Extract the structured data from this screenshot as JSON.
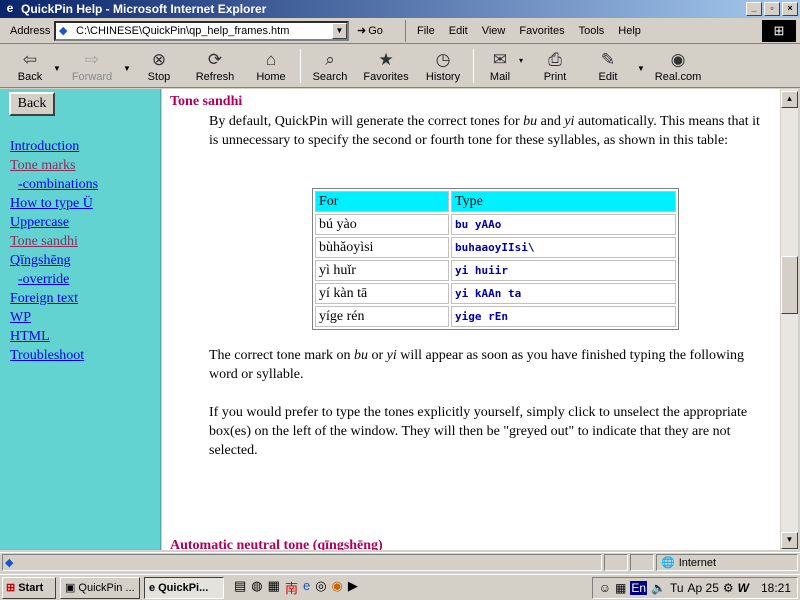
{
  "window": {
    "title": "QuickPin Help - Microsoft Internet Explorer"
  },
  "address": {
    "label": "Address",
    "value": "C:\\CHINESE\\QuickPin\\qp_help_frames.htm",
    "go": "Go"
  },
  "menu": [
    "File",
    "Edit",
    "View",
    "Favorites",
    "Tools",
    "Help"
  ],
  "toolbar": {
    "back": "Back",
    "forward": "Forward",
    "stop": "Stop",
    "refresh": "Refresh",
    "home": "Home",
    "search": "Search",
    "favorites": "Favorites",
    "history": "History",
    "mail": "Mail",
    "print": "Print",
    "edit": "Edit",
    "real": "Real.com"
  },
  "sidebar": {
    "back_button": "Back",
    "links": [
      "Introduction",
      "Tone marks",
      "-combinations",
      "How to type Ü",
      "Uppercase",
      "Tone sandhi",
      "Qīngshēng",
      "-override",
      "Foreign text",
      "WP",
      "HTML",
      "Troubleshoot"
    ]
  },
  "content": {
    "heading": "Tone sandhi",
    "para1_a": "By default, QuickPin will generate the correct tones for ",
    "para1_bu": "bu",
    "para1_and": " and ",
    "para1_yi": "yi",
    "para1_b": " automatically. This means that it is unnecessary to specify the second or fourth tone for these syllables, as shown in this table:",
    "table": {
      "headers": [
        "For",
        "Type"
      ],
      "rows": [
        [
          "bú yào",
          "bu yAAo"
        ],
        [
          "bùhǎoyìsi",
          "buhaaoyIIsi\\"
        ],
        [
          "yì huǐr",
          "yi huiir"
        ],
        [
          "yí kàn tā",
          "yi kAAn ta"
        ],
        [
          "yíge rén",
          "yige rEn"
        ]
      ]
    },
    "para2_a": "The correct tone mark on ",
    "para2_bu": "bu",
    "para2_or": " or ",
    "para2_yi": "yi",
    "para2_b": " will appear as soon as you have finished typing the following word or syllable.",
    "para3": "If you would prefer to type the tones explicitly yourself, simply click to unselect the appropriate box(es) on the left of the window. They will then be \"greyed out\" to indicate that they are not selected.",
    "heading2": "Automatic neutral tone (qīngshēng)"
  },
  "status": {
    "zone": "Internet"
  },
  "taskbar": {
    "start": "Start",
    "tasks": [
      "QuickPin ...",
      "QuickPi..."
    ],
    "tray": {
      "ime1": "En",
      "ime2": "Tu",
      "date": "Ap 25",
      "time": "18:21"
    }
  },
  "colors": {
    "sidebar": "#63d3d2",
    "heading": "#b0005a",
    "table_header": "#00f0ff",
    "code": "#0000aa"
  }
}
